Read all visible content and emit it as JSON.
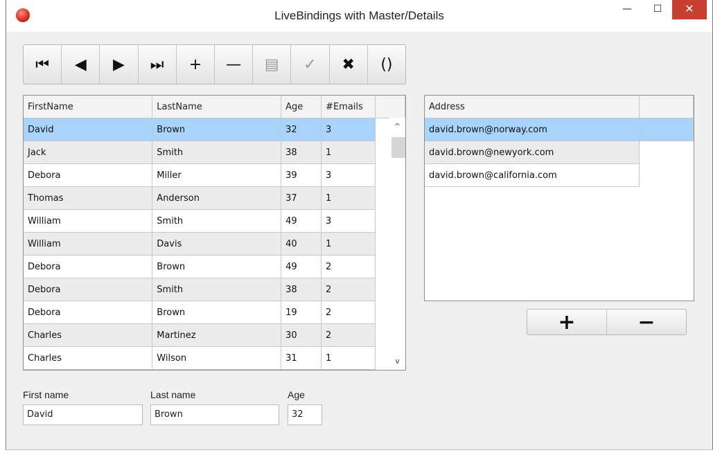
{
  "window": {
    "title": "LiveBindings with Master/Details",
    "minimize_glyph": "—",
    "maximize_glyph": "☐",
    "close_glyph": "✕",
    "app_icon": "app-logo-icon"
  },
  "navigator": {
    "buttons": [
      {
        "name": "first-record-button",
        "glyph": "⏮",
        "icon": "first-icon",
        "enabled": true
      },
      {
        "name": "prior-record-button",
        "glyph": "◀",
        "icon": "prior-icon",
        "enabled": true
      },
      {
        "name": "next-record-button",
        "glyph": "▶",
        "icon": "next-icon",
        "enabled": true
      },
      {
        "name": "last-record-button",
        "glyph": "⏭",
        "icon": "last-icon",
        "enabled": true
      },
      {
        "name": "insert-record-button",
        "glyph": "+",
        "icon": "plus-icon",
        "enabled": true
      },
      {
        "name": "delete-record-button",
        "glyph": "—",
        "icon": "minus-icon",
        "enabled": true
      },
      {
        "name": "edit-record-button",
        "glyph": "▤",
        "icon": "edit-icon",
        "enabled": false
      },
      {
        "name": "post-record-button",
        "glyph": "✓",
        "icon": "check-icon",
        "enabled": false
      },
      {
        "name": "cancel-record-button",
        "glyph": "✖",
        "icon": "cancel-icon",
        "enabled": true
      },
      {
        "name": "refresh-button",
        "glyph": "()",
        "icon": "refresh-icon",
        "enabled": true
      }
    ]
  },
  "master_grid": {
    "columns": [
      "FirstName",
      "LastName",
      "Age",
      "#Emails"
    ],
    "rows": [
      [
        "David",
        "Brown",
        "32",
        "3"
      ],
      [
        "Jack",
        "Smith",
        "38",
        "1"
      ],
      [
        "Debora",
        "Miller",
        "39",
        "3"
      ],
      [
        "Thomas",
        "Anderson",
        "37",
        "1"
      ],
      [
        "William",
        "Smith",
        "49",
        "3"
      ],
      [
        "William",
        "Davis",
        "40",
        "1"
      ],
      [
        "Debora",
        "Brown",
        "49",
        "2"
      ],
      [
        "Debora",
        "Smith",
        "38",
        "2"
      ],
      [
        "Debora",
        "Brown",
        "19",
        "2"
      ],
      [
        "Charles",
        "Martinez",
        "30",
        "2"
      ],
      [
        "Charles",
        "Wilson",
        "31",
        "1"
      ]
    ],
    "selected_row": 0,
    "scroll_up_glyph": "^",
    "scroll_down_glyph": "v"
  },
  "detail_grid": {
    "columns": [
      "Address"
    ],
    "rows": [
      [
        "david.brown@norway.com"
      ],
      [
        "david.brown@newyork.com"
      ],
      [
        "david.brown@california.com"
      ]
    ],
    "selected_row": 0
  },
  "detail_buttons": {
    "add_glyph": "+",
    "remove_glyph": "−"
  },
  "form": {
    "first_name_label": "First name",
    "first_name_value": "David",
    "last_name_label": "Last name",
    "last_name_value": "Brown",
    "age_label": "Age",
    "age_value": "32"
  },
  "colors": {
    "selection": "#a8d3fb",
    "close_button": "#c7402f",
    "window_background": "#f0f0f0"
  }
}
